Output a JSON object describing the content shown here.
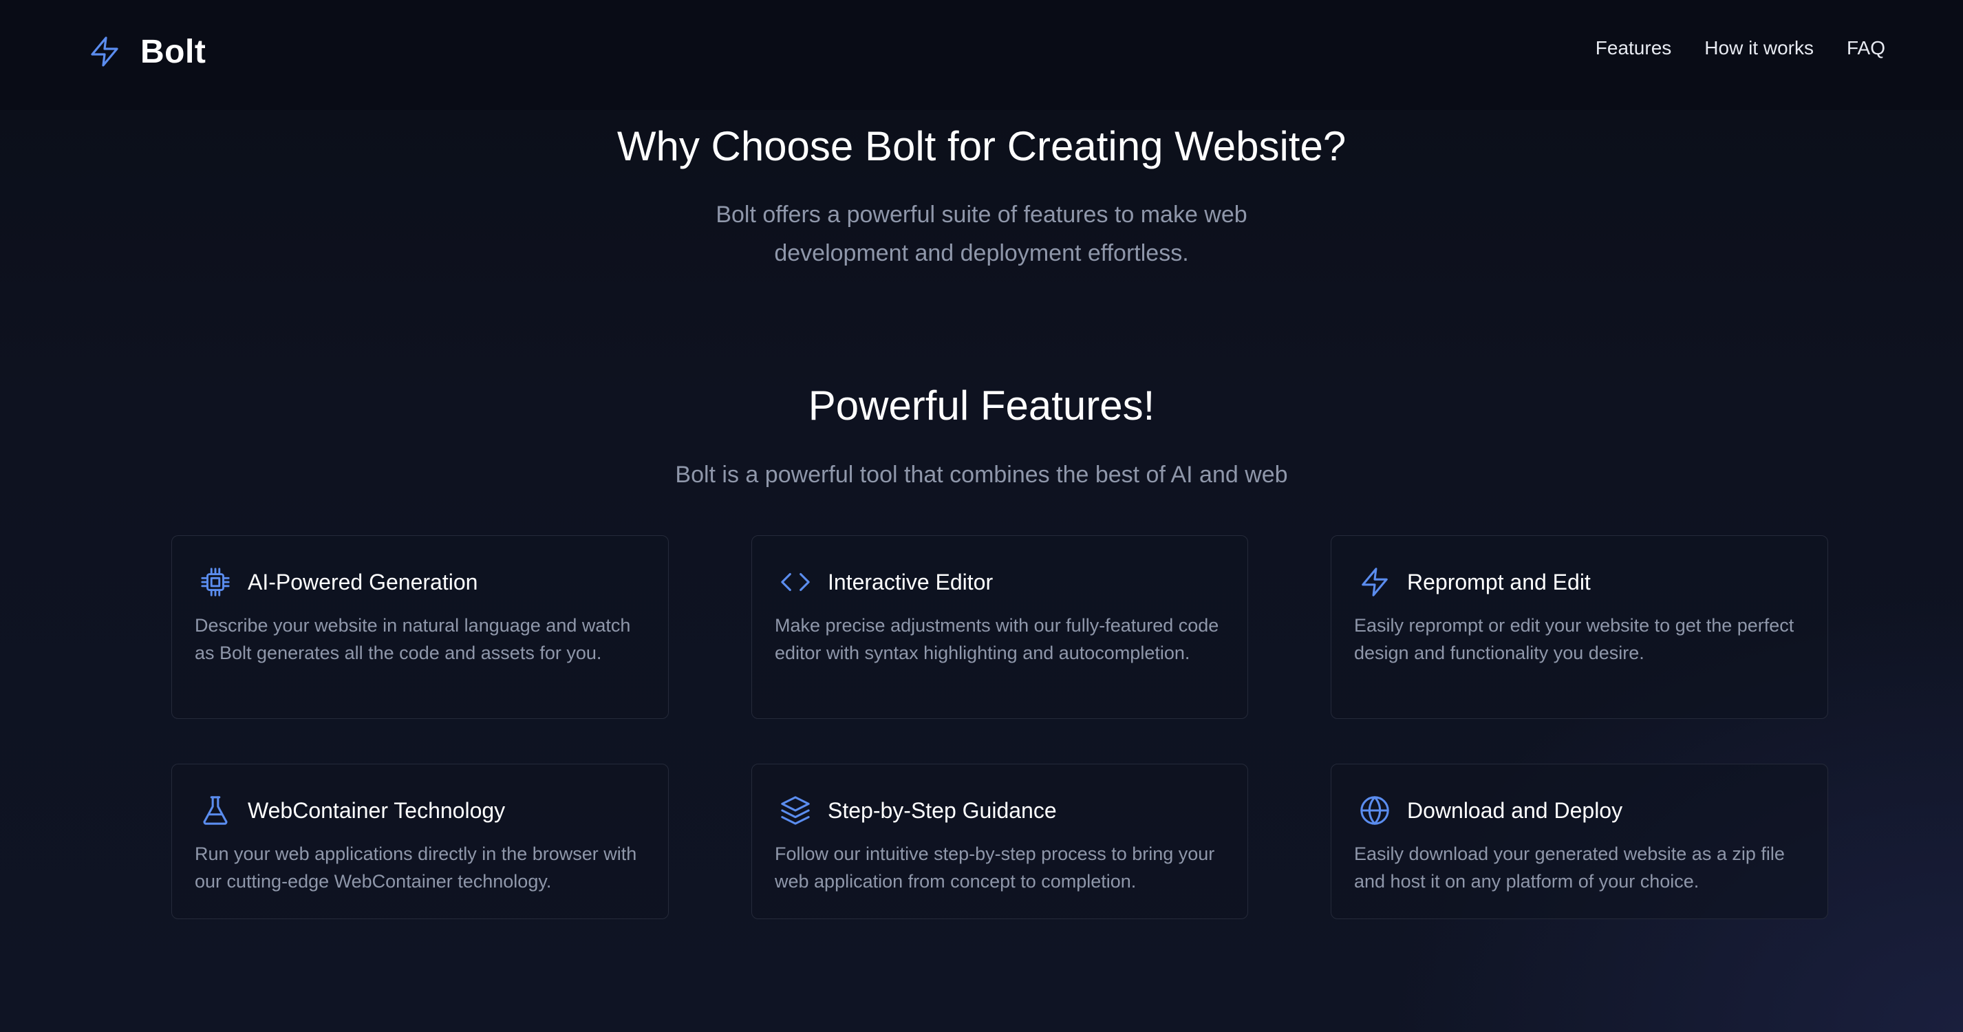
{
  "brand": {
    "name": "Bolt",
    "icon": "lightning-bolt-icon",
    "accent_color": "#5b8def"
  },
  "nav": {
    "links": [
      {
        "label": "Features"
      },
      {
        "label": "How it works"
      },
      {
        "label": "FAQ"
      }
    ]
  },
  "why": {
    "title": "Why Choose Bolt for Creating Website?",
    "subtitle_line1": "Bolt offers a powerful suite of features to make web",
    "subtitle_line2": "development and deployment effortless."
  },
  "features": {
    "title": "Powerful Features!",
    "subtitle": "Bolt is a powerful tool that combines the best of AI and web",
    "cards": [
      {
        "icon": "cpu-chip-icon",
        "title": "AI-Powered Generation",
        "description": "Describe your website in natural language and watch as Bolt generates all the code and assets for you."
      },
      {
        "icon": "code-brackets-icon",
        "title": "Interactive Editor",
        "description": "Make precise adjustments with our fully-featured code editor with syntax highlighting and autocompletion."
      },
      {
        "icon": "lightning-bolt-icon",
        "title": "Reprompt and Edit",
        "description": "Easily reprompt or edit your website to get the perfect design and functionality you desire."
      },
      {
        "icon": "flask-icon",
        "title": "WebContainer Technology",
        "description": "Run your web applications directly in the browser with our cutting-edge WebContainer technology."
      },
      {
        "icon": "layers-icon",
        "title": "Step-by-Step Guidance",
        "description": "Follow our intuitive step-by-step process to bring your web application from concept to completion."
      },
      {
        "icon": "globe-icon",
        "title": "Download and Deploy",
        "description": "Easily download your generated website as a zip file and host it on any platform of your choice."
      }
    ]
  }
}
